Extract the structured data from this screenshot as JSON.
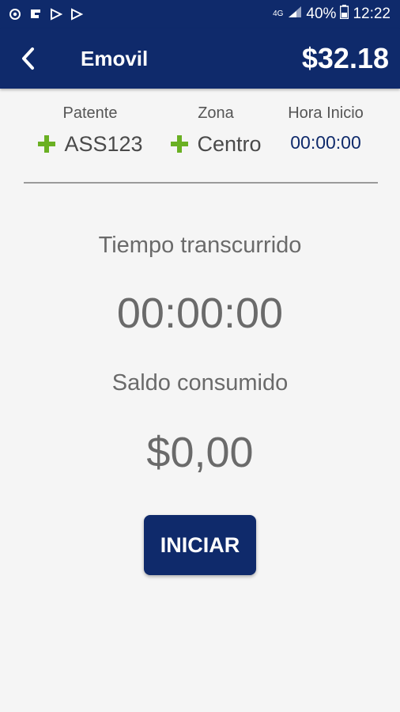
{
  "status_bar": {
    "network": "4G",
    "battery": "40%",
    "time": "12:22",
    "left_icons": [
      "sync-icon",
      "app-notification-icon",
      "flag-icon",
      "flag-icon"
    ]
  },
  "header": {
    "title": "Emovil",
    "balance": "$32.18",
    "color": "#0f2a6b"
  },
  "info": {
    "patente": {
      "label": "Patente",
      "value": "ASS123"
    },
    "zona": {
      "label": "Zona",
      "value": "Centro"
    },
    "hora_inicio": {
      "label": "Hora Inicio",
      "value": "00:00:00"
    },
    "plus_color": "#6ab023"
  },
  "timer": {
    "elapsed_label": "Tiempo transcurrido",
    "elapsed_value": "00:00:00",
    "consumed_label": "Saldo consumido",
    "consumed_value": "$0,00"
  },
  "actions": {
    "start_label": "INICIAR"
  }
}
